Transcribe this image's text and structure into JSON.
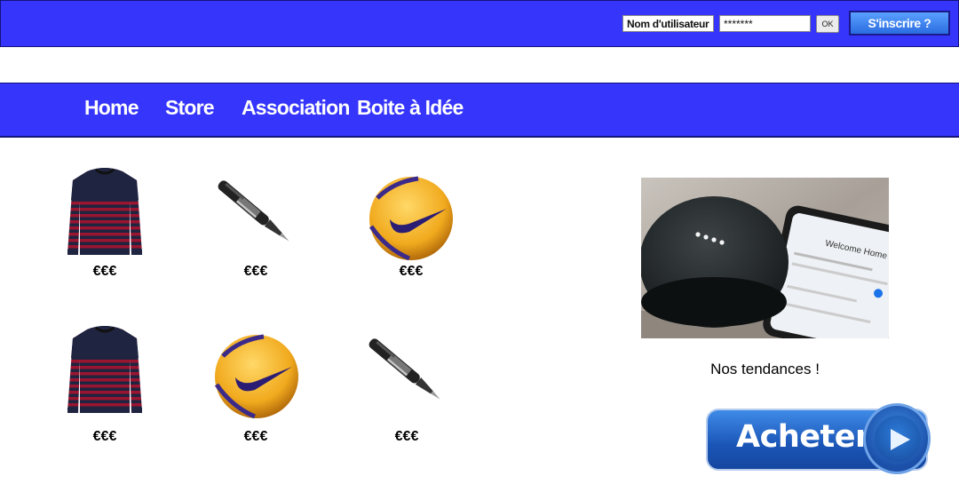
{
  "login": {
    "username_value": "Nom d'utilisateur",
    "password_value": "*******",
    "ok_label": "OK",
    "signup_label": "S'inscrire ?"
  },
  "nav": {
    "items": [
      {
        "label": "Home"
      },
      {
        "label": "Store"
      },
      {
        "label": "Association"
      },
      {
        "label": "Boite à Idée"
      }
    ]
  },
  "products": [
    {
      "icon": "sweater-icon",
      "price": "€€€"
    },
    {
      "icon": "pen-icon",
      "price": "€€€"
    },
    {
      "icon": "ball-icon",
      "price": "€€€"
    },
    {
      "icon": "sweater-icon",
      "price": "€€€"
    },
    {
      "icon": "ball-icon",
      "price": "€€€"
    },
    {
      "icon": "pen-icon",
      "price": "€€€"
    }
  ],
  "sidebar": {
    "tendance_label": "Nos tendances !",
    "phone_screen_text": "Welcome Home",
    "buy_label": "Acheter"
  },
  "colors": {
    "bar_blue": "#3535fb",
    "button_blue": "#1a55b6"
  }
}
